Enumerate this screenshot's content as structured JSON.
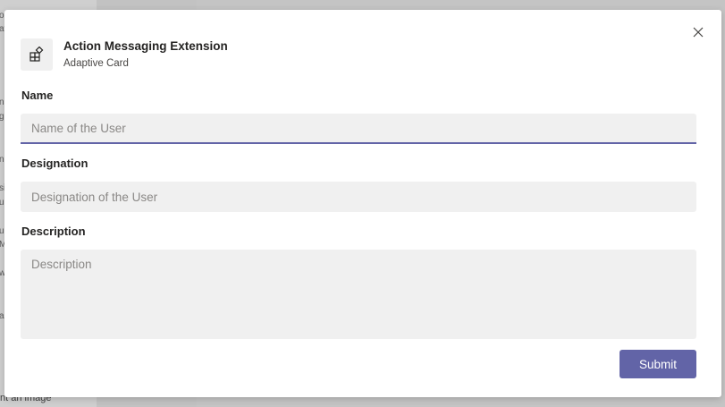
{
  "background": {
    "snippets": [
      "o",
      "av",
      "na",
      "g",
      "ne",
      "si",
      "ur",
      "ur",
      "Mi",
      "w",
      "a"
    ],
    "bottom_text": "nt an image"
  },
  "dialog": {
    "app_icon": "apps-grid-icon",
    "title": "Action Messaging Extension",
    "subtitle": "Adaptive Card",
    "close_icon": "close-icon",
    "fields": {
      "name": {
        "label": "Name",
        "placeholder": "Name of the User",
        "value": ""
      },
      "designation": {
        "label": "Designation",
        "placeholder": "Designation of the User",
        "value": ""
      },
      "description": {
        "label": "Description",
        "placeholder": "Description",
        "value": ""
      }
    },
    "submit_label": "Submit"
  },
  "colors": {
    "accent": "#6264a7",
    "input_background": "#f0f0f0",
    "dialog_background": "#ffffff",
    "overlay": "#c4c4c4"
  }
}
